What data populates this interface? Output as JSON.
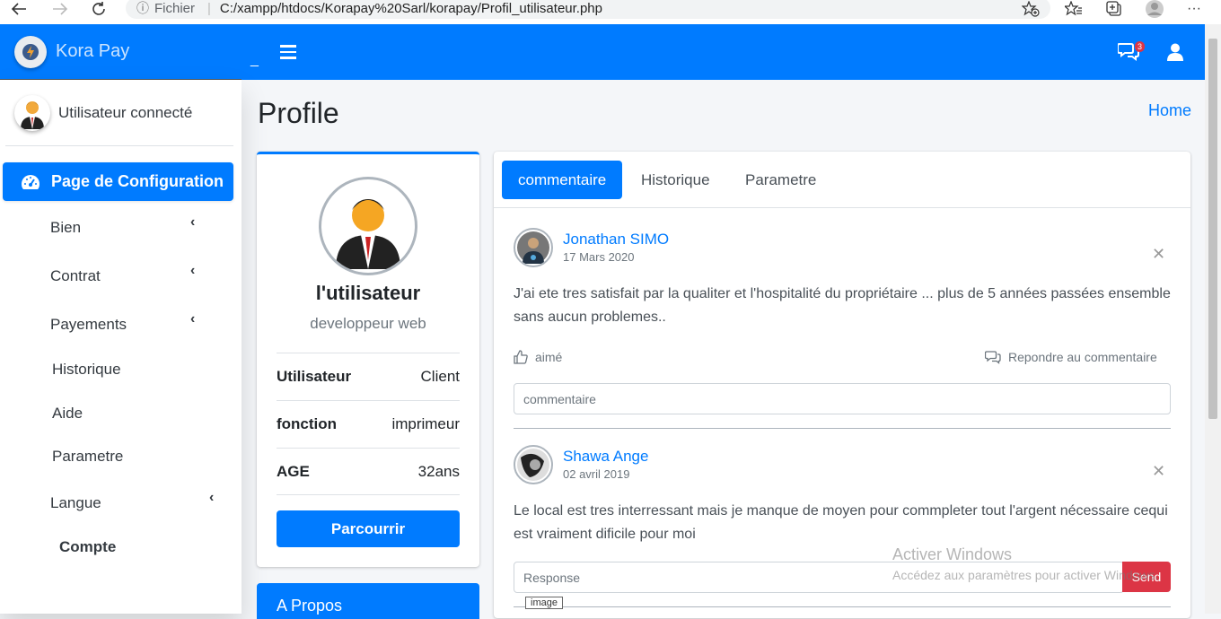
{
  "browser": {
    "info_icon": "ⓘ",
    "scheme_label": "Fichier",
    "url": "C:/xampp/htdocs/Korapay%20Sarl/korapay/Profil_utilisateur.php"
  },
  "brand": {
    "name": "Kora Pay"
  },
  "topnav": {
    "underscore": "_",
    "notification_count": "3"
  },
  "sidebar": {
    "user_name": "Utilisateur connecté",
    "active_item": "Page de Configuration",
    "items": [
      {
        "label": "Bien",
        "chevron": "‹"
      },
      {
        "label": "Contrat",
        "chevron": "‹"
      },
      {
        "label": "Payements",
        "chevron": "‹"
      },
      {
        "label": "Historique"
      },
      {
        "label": "Aide"
      },
      {
        "label": "Parametre"
      },
      {
        "label": "Langue",
        "chevron": "‹"
      },
      {
        "label": "Compte"
      }
    ]
  },
  "header": {
    "title": "Profile",
    "breadcrumb_home": "Home"
  },
  "profile": {
    "name": "l'utilisateur",
    "role": "developpeur web",
    "rows": [
      {
        "label": "Utilisateur",
        "value": "Client"
      },
      {
        "label": "fonction",
        "value": "imprimeur"
      },
      {
        "label": "AGE",
        "value": "32ans"
      }
    ],
    "button": "Parcourrir"
  },
  "about": {
    "title": "A Propos"
  },
  "tabs": [
    "commentaire",
    "Historique",
    "Parametre"
  ],
  "posts": [
    {
      "author": "Jonathan SIMO",
      "date": "17 Mars 2020",
      "text": "J'ai ete tres satisfait par la qualiter et l'hospitalité du propriétaire ... plus de 5 années passées ensemble sans aucun problemes..",
      "like_label": "aimé",
      "reply_label": "Repondre au commentaire",
      "input_placeholder": "commentaire"
    },
    {
      "author": "Shawa Ange",
      "date": "02 avril 2019",
      "text": "Le local est tres interressant mais je manque de moyen pour commpleter tout l'argent nécessaire cequi est vraiment dificile pour moi",
      "input_placeholder": "Response",
      "send_label": "Send",
      "tooltip": "image"
    }
  ],
  "close_glyph": "✕",
  "watermark": {
    "line1": "Activer Windows",
    "line2": "Accédez aux paramètres pour activer Windows."
  },
  "colors": {
    "primary": "#007bff",
    "danger": "#dc3545"
  }
}
